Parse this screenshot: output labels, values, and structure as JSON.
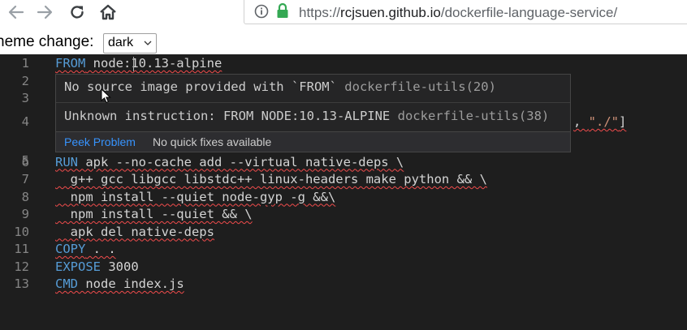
{
  "browser": {
    "url_scheme": "https://",
    "url_host": "rcjsuen.github.io",
    "url_path": "/dockerfile-language-service/"
  },
  "theme": {
    "label": "heme change:",
    "selected": "dark"
  },
  "editor": {
    "line_numbers": [
      "1",
      "2",
      "3",
      "4",
      "5",
      "6",
      "7",
      "8",
      "9",
      "10",
      "11",
      "12",
      "13"
    ],
    "lines": {
      "l1_kw": "FROM",
      "l1_rest": " node:10.13-alpine",
      "l4_tail_punct": ", ",
      "l4_tail_str": "\"./\"",
      "l4_tail_end": "]",
      "l6_kw": "RUN",
      "l6_rest": " apk --no-cache add --virtual native-deps \\",
      "l7": "  g++ gcc libgcc libstdc++ linux-headers make python && \\",
      "l8": "  npm install --quiet node-gyp -g &&\\",
      "l9": "  npm install --quiet && \\",
      "l10": "  apk del native-deps",
      "l11_kw": "COPY",
      "l11_rest": " . .",
      "l12_kw": "EXPOSE",
      "l12_rest": " 3000",
      "l13_kw": "CMD",
      "l13_rest": " node index.js"
    }
  },
  "hover": {
    "message_1": "No source image provided with `FROM`",
    "source_1": "dockerfile-utils(20)",
    "message_2": "Unknown instruction: FROM NODE:10.13-ALPINE",
    "source_2": "dockerfile-utils(38)",
    "peek_problem": "Peek Problem",
    "no_quick_fixes": "No quick fixes available"
  },
  "colors": {
    "editor_background": "#1e1e1e",
    "keyword": "#569cd6",
    "error_squiggle": "#f14c4c",
    "link": "#3794ff",
    "secure_lock": "#34a853"
  },
  "icons": [
    "back-icon",
    "forward-icon",
    "reload-icon",
    "home-icon",
    "info-icon",
    "lock-icon",
    "chevron-down-icon",
    "mouse-pointer-icon"
  ]
}
